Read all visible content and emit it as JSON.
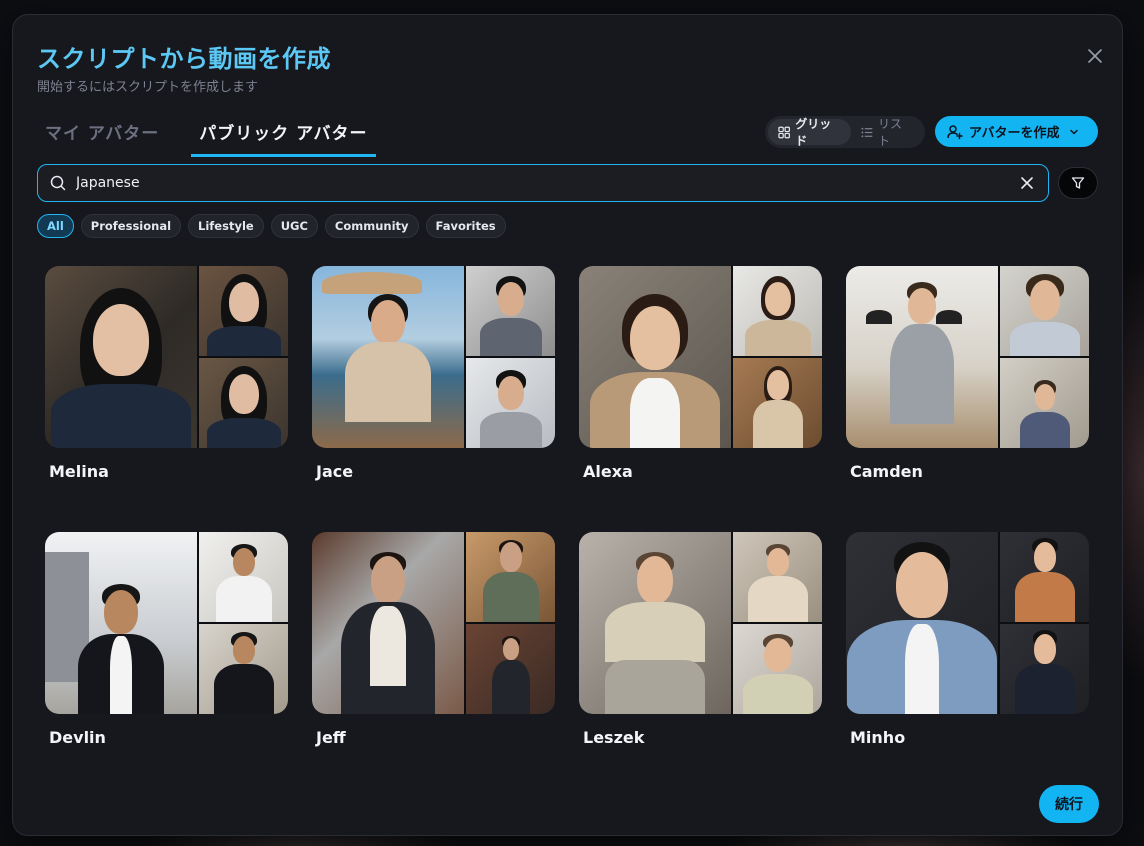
{
  "dialog": {
    "title": "スクリプトから動画を作成",
    "subtitle": "開始するにはスクリプトを作成します"
  },
  "tabs": [
    {
      "label": "マイ アバター",
      "active": false
    },
    {
      "label": "パブリック アバター",
      "active": true
    }
  ],
  "view_toggle": {
    "grid_label": "グリッド",
    "list_label": "リスト",
    "active": "grid"
  },
  "create_button": {
    "label": "アバターを作成"
  },
  "search": {
    "value": "Japanese",
    "placeholder": ""
  },
  "chips": [
    {
      "label": "All",
      "active": true
    },
    {
      "label": "Professional",
      "active": false
    },
    {
      "label": "Lifestyle",
      "active": false
    },
    {
      "label": "UGC",
      "active": false
    },
    {
      "label": "Community",
      "active": false
    },
    {
      "label": "Favorites",
      "active": false
    }
  ],
  "avatars": [
    {
      "name": "Melina"
    },
    {
      "name": "Jace"
    },
    {
      "name": "Alexa"
    },
    {
      "name": "Camden"
    },
    {
      "name": "Devlin"
    },
    {
      "name": "Jeff"
    },
    {
      "name": "Leszek"
    },
    {
      "name": "Minho"
    }
  ],
  "footer": {
    "continue_label": "続行"
  },
  "colors": {
    "accent": "#12b4f2",
    "title": "#5cc8f5",
    "modal_bg": "#17181d"
  }
}
